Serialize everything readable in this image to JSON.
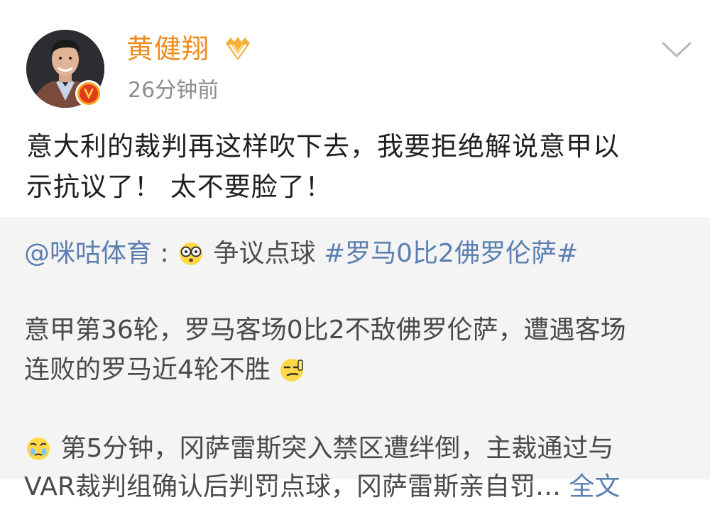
{
  "author": {
    "name": "黄健翔",
    "time": "26分钟前"
  },
  "post": {
    "text": "意大利的裁判再这样吹下去，我要拒绝解说意甲以\n示抗议了！ 太不要脸了！"
  },
  "repost": {
    "mention": "@咪咕体育",
    "separator": ":",
    "reason": "争议点球",
    "hashtag": "#罗马0比2佛罗伦萨#",
    "paragraph1": "意甲第36轮，罗马客场0比2不敌佛罗伦萨，遭遇客场\n连败的罗马近4轮不胜",
    "paragraph2_line1": "第5分钟，冈萨雷斯突入禁区遭绊倒，主裁通过与",
    "paragraph2_line2": "VAR裁判组确认后判罚点球，冈萨雷斯亲自罚…",
    "more_label": "全文"
  },
  "colors": {
    "username": "#f08a1d",
    "link": "#5b7fb1",
    "repost_bg": "#f4f4f4",
    "timestamp": "#8d8d8d"
  },
  "icons": {
    "verified": "verified-v-icon",
    "vip": "vip-badge-icon",
    "expand": "chevron-down-icon",
    "emoji_shocked": "shocked-face-emoji",
    "emoji_smirk": "smirk-face-emoji",
    "emoji_crying": "crying-face-emoji"
  }
}
